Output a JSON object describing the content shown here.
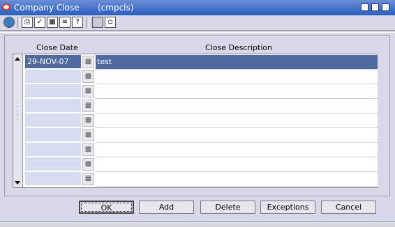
{
  "window": {
    "title": "Company Close",
    "module": "(cmpcls)"
  },
  "toolbar": {
    "tools": [
      "globe-icon",
      "print-icon",
      "spell-check-icon",
      "calendar-icon",
      "notes-icon",
      "help-icon",
      "blank-icon",
      "new-doc-icon"
    ]
  },
  "table": {
    "headers": {
      "date": "Close Date",
      "description": "Close Description"
    },
    "rows": [
      {
        "date": "29-NOV-07",
        "description": "test",
        "selected": true
      },
      {
        "date": "",
        "description": ""
      },
      {
        "date": "",
        "description": ""
      },
      {
        "date": "",
        "description": ""
      },
      {
        "date": "",
        "description": ""
      },
      {
        "date": "",
        "description": ""
      },
      {
        "date": "",
        "description": ""
      },
      {
        "date": "",
        "description": ""
      },
      {
        "date": "",
        "description": ""
      }
    ]
  },
  "buttons": {
    "ok": "OK",
    "add": "Add",
    "delete": "Delete",
    "exceptions": "Exceptions",
    "cancel": "Cancel"
  },
  "colors": {
    "title_bar": "#2c5cc1",
    "selection": "#4e6a9e",
    "background": "#d8d8e8"
  }
}
